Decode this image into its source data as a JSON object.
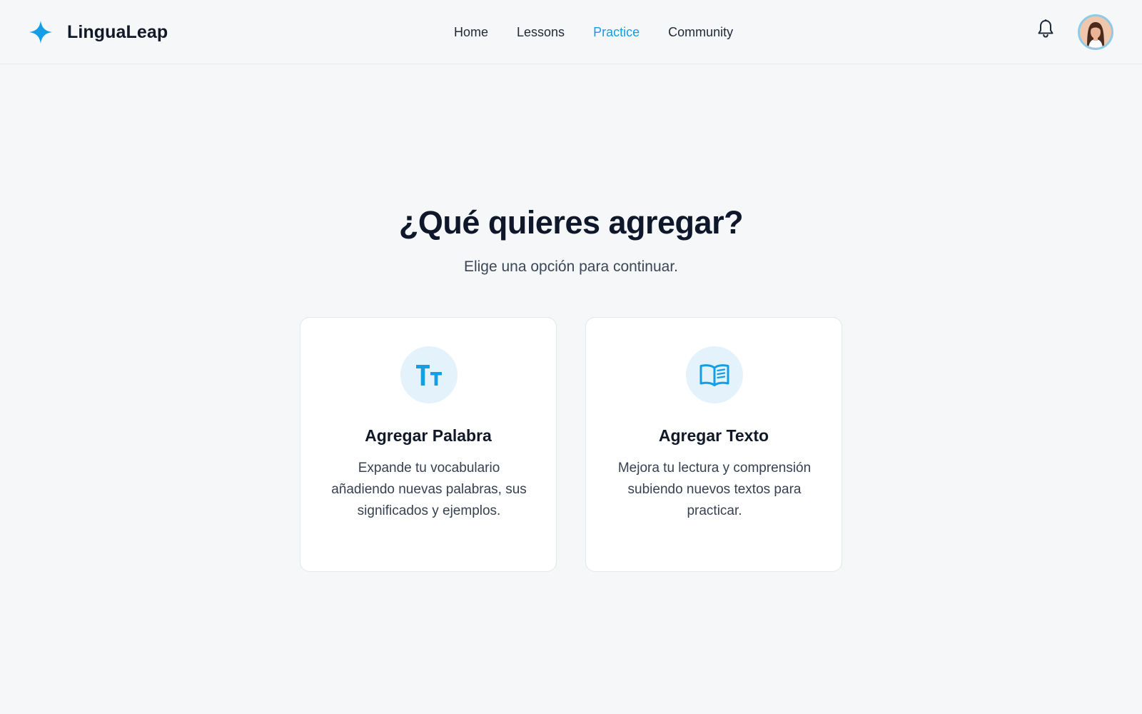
{
  "app": {
    "brand_name": "LinguaLeap",
    "brand_icon": "sparkle-star-icon",
    "accent_color": "#139ee5"
  },
  "nav": {
    "items": [
      {
        "label": "Home",
        "active": false
      },
      {
        "label": "Lessons",
        "active": false
      },
      {
        "label": "Practice",
        "active": true
      },
      {
        "label": "Community",
        "active": false
      }
    ]
  },
  "header_actions": {
    "notifications_icon": "bell-icon",
    "avatar_icon": "user-avatar"
  },
  "main": {
    "title": "¿Qué quieres agregar?",
    "subtitle": "Elige una opción para continuar.",
    "cards": [
      {
        "icon": "text-size-icon",
        "title": "Agregar Palabra",
        "description": "Expande tu vocabulario añadiendo nuevas palabras, sus significados y ejemplos."
      },
      {
        "icon": "open-book-icon",
        "title": "Agregar Texto",
        "description": "Mejora tu lectura y comprensión subiendo nuevos textos para practicar."
      }
    ]
  }
}
